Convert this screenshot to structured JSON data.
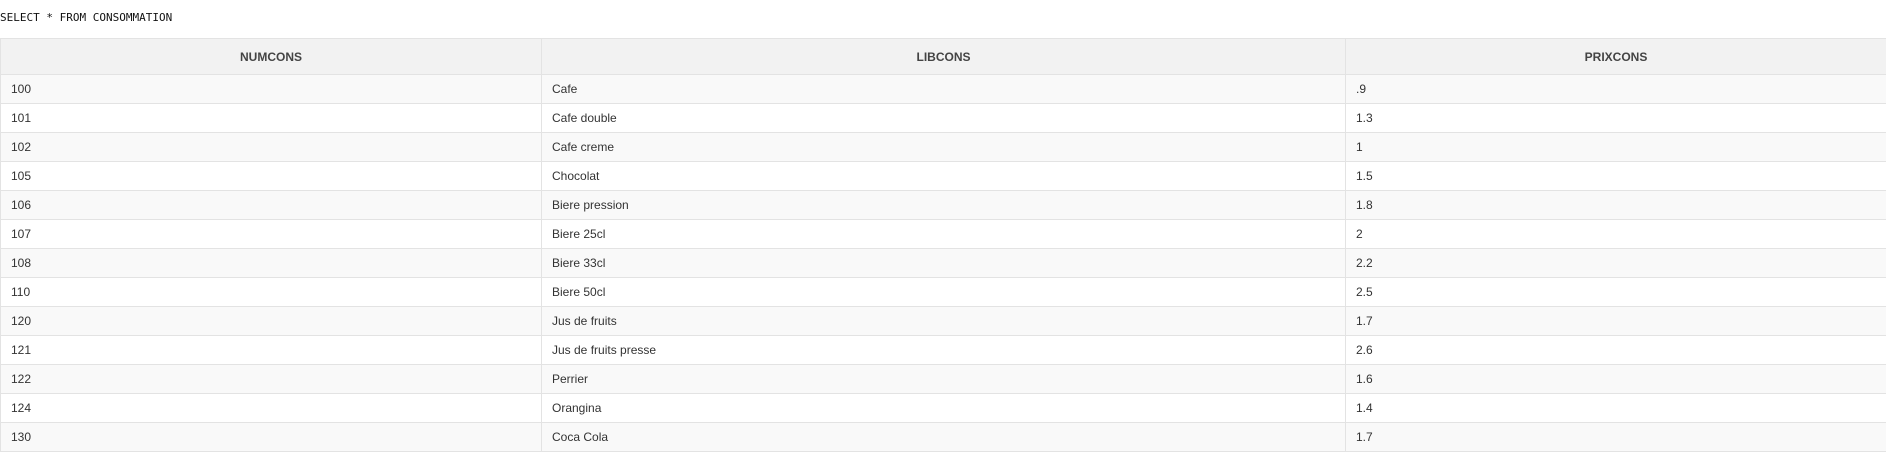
{
  "query": {
    "text": "SELECT * FROM CONSOMMATION"
  },
  "table": {
    "columns": [
      "NUMCONS",
      "LIBCONS",
      "PRIXCONS"
    ],
    "rows": [
      [
        "100",
        "Cafe",
        ".9"
      ],
      [
        "101",
        "Cafe double",
        "1.3"
      ],
      [
        "102",
        "Cafe creme",
        "1"
      ],
      [
        "105",
        "Chocolat",
        "1.5"
      ],
      [
        "106",
        "Biere pression",
        "1.8"
      ],
      [
        "107",
        "Biere 25cl",
        "2"
      ],
      [
        "108",
        "Biere 33cl",
        "2.2"
      ],
      [
        "110",
        "Biere 50cl",
        "2.5"
      ],
      [
        "120",
        "Jus de fruits",
        "1.7"
      ],
      [
        "121",
        "Jus de fruits presse",
        "2.6"
      ],
      [
        "122",
        "Perrier",
        "1.6"
      ],
      [
        "124",
        "Orangina",
        "1.4"
      ],
      [
        "130",
        "Coca Cola",
        "1.7"
      ]
    ]
  }
}
